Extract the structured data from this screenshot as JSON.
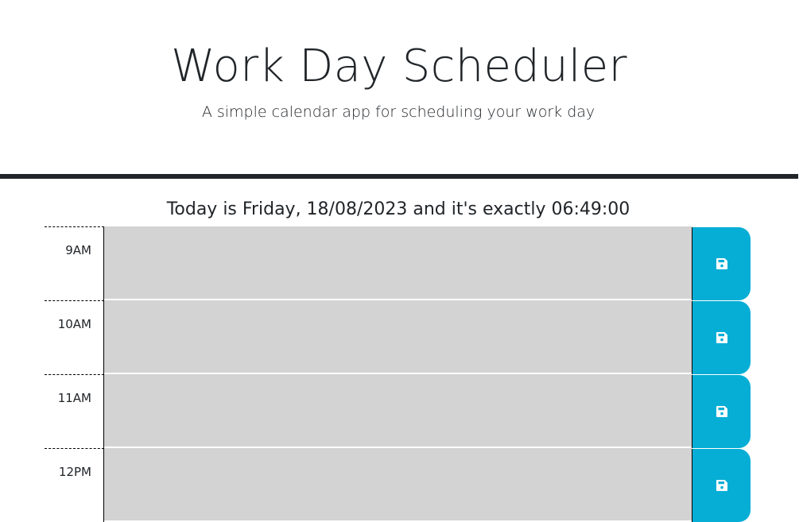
{
  "header": {
    "title": "Work Day Scheduler",
    "subtitle": "A simple calendar app for scheduling your work day"
  },
  "current_day": "Today is Friday, 18/08/2023 and it's exactly 06:49:00",
  "time_blocks": [
    {
      "hour": "9AM",
      "description": "",
      "save_icon": "save-icon"
    },
    {
      "hour": "10AM",
      "description": "",
      "save_icon": "save-icon"
    },
    {
      "hour": "11AM",
      "description": "",
      "save_icon": "save-icon"
    },
    {
      "hour": "12PM",
      "description": "",
      "save_icon": "save-icon"
    }
  ],
  "colors": {
    "past": "#d3d3d3",
    "save_button": "#06aed5",
    "divider": "#212529"
  }
}
